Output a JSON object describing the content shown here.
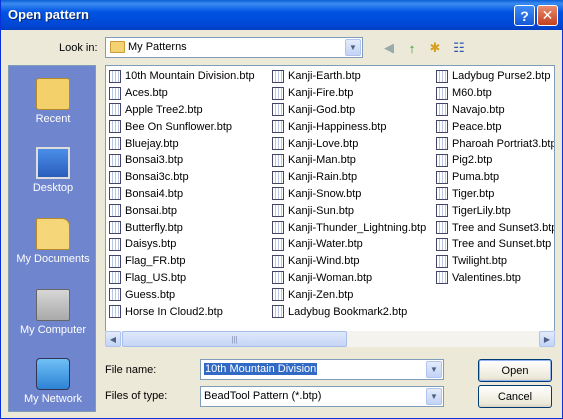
{
  "window": {
    "title": "Open pattern"
  },
  "look_in": {
    "label": "Look in:",
    "value": "My Patterns"
  },
  "places": [
    "Recent",
    "Desktop",
    "My Documents",
    "My Computer",
    "My Network"
  ],
  "files": {
    "col1": [
      "10th Mountain Division.btp",
      "Aces.btp",
      "Apple Tree2.btp",
      "Bee On Sunflower.btp",
      "Bluejay.btp",
      "Bonsai3.btp",
      "Bonsai3c.btp",
      "Bonsai4.btp",
      "Bonsai.btp",
      "Butterfly.btp",
      "Daisys.btp",
      "Flag_FR.btp",
      "Flag_US.btp",
      "Guess.btp",
      "Horse In Cloud2.btp"
    ],
    "col2": [
      "Kanji-Earth.btp",
      "Kanji-Fire.btp",
      "Kanji-God.btp",
      "Kanji-Happiness.btp",
      "Kanji-Love.btp",
      "Kanji-Man.btp",
      "Kanji-Rain.btp",
      "Kanji-Snow.btp",
      "Kanji-Sun.btp",
      "Kanji-Thunder_Lightning.btp",
      "Kanji-Water.btp",
      "Kanji-Wind.btp",
      "Kanji-Woman.btp",
      "Kanji-Zen.btp",
      "Ladybug Bookmark2.btp"
    ],
    "col3": [
      "Ladybug Purse2.btp",
      "M60.btp",
      "Navajo.btp",
      "Peace.btp",
      "Pharoah Portriat3.btp",
      "Pig2.btp",
      "Puma.btp",
      "Tiger.btp",
      "TigerLily.btp",
      "Tree and Sunset3.btp",
      "Tree and Sunset.btp",
      "Twilight.btp",
      "Valentines.btp"
    ]
  },
  "filename": {
    "label": "File name:",
    "value": "10th Mountain Division"
  },
  "filetype": {
    "label": "Files of type:",
    "value": "BeadTool Pattern (*.btp)"
  },
  "buttons": {
    "open": "Open",
    "cancel": "Cancel"
  },
  "icons": {
    "help": "?",
    "close": "✕",
    "back": "◀",
    "up": "↑",
    "new_folder": "✱",
    "views": "☷"
  }
}
